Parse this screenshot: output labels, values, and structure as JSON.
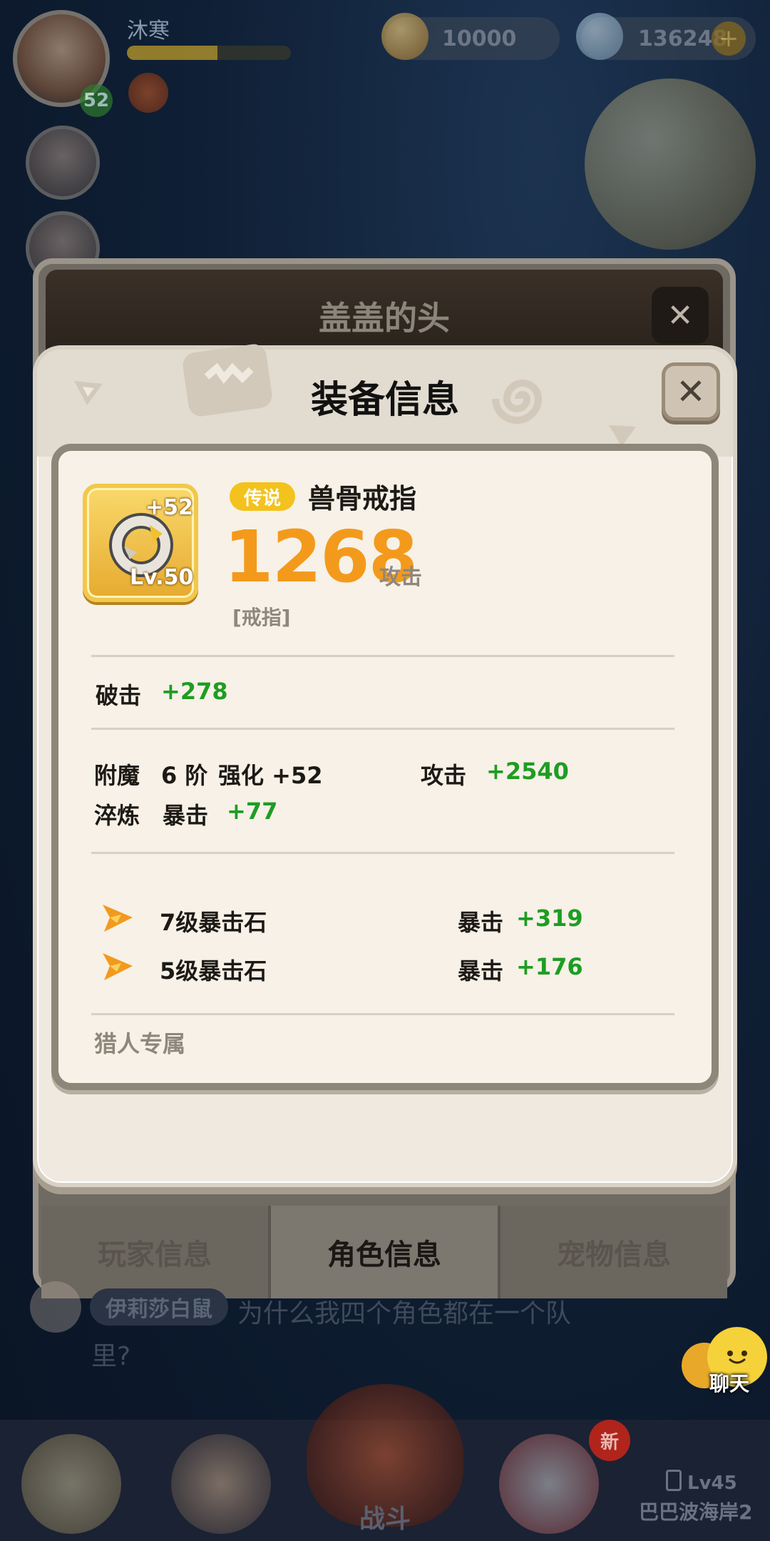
{
  "hud": {
    "player_name": "沐寒",
    "level": "52",
    "gold": "10000",
    "gems": "136248",
    "add_label": "+",
    "exp_progress": 0.55
  },
  "back_dialog": {
    "title": "盖盖的头",
    "close_label": "✕",
    "tabs": [
      "玩家信息",
      "角色信息",
      "宠物信息"
    ],
    "active_tab": 1
  },
  "chat_preview": {
    "sender": "伊莉莎白鼠",
    "message": "为什么我四个角色都在一个队里?"
  },
  "chat_button": {
    "label": "聊天"
  },
  "bottom_nav": {
    "fight_label": "战斗",
    "new_badge": "新",
    "map_level": "Lv45",
    "map_name": "巴巴波海岸2"
  },
  "equip_dialog": {
    "title": "装备信息",
    "close_label": "✕",
    "item": {
      "rarity": "传说",
      "name": "兽骨戒指",
      "attack_value": "1268",
      "attack_label": "攻击",
      "type": "[戒指]",
      "plus": "+52",
      "level": "Lv.50",
      "icon": "bone-ring-icon"
    },
    "base_stats": [
      {
        "label": "破击",
        "value": "+278"
      }
    ],
    "enchant": {
      "label": "附魔",
      "tier": "6 阶",
      "strengthen": "强化 +52",
      "bonus_label": "攻击",
      "bonus_value": "+2540"
    },
    "temper": {
      "label": "淬炼",
      "stat_label": "暴击",
      "stat_value": "+77"
    },
    "gems": [
      {
        "name": "7级暴击石",
        "stat_label": "暴击",
        "stat_value": "+319",
        "icon": "crit-stone-icon"
      },
      {
        "name": "5级暴击石",
        "stat_label": "暴击",
        "stat_value": "+176",
        "icon": "crit-stone-icon"
      }
    ],
    "exclusive": "猎人专属"
  },
  "colors": {
    "accent_orange": "#f39a1c",
    "stat_green": "#1e9d22",
    "legend_badge": "#f3c21c",
    "panel_bg": "#f7f1e7"
  }
}
